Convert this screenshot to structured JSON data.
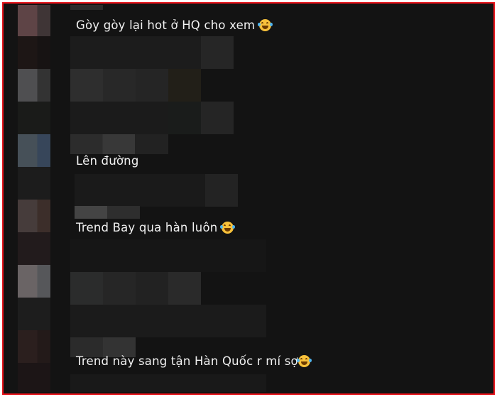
{
  "comments": [
    {
      "text": "Gòy gòy lại hot ở HQ cho xem",
      "emoji": "laughing-tears-icon"
    },
    {
      "text": "Lên đường",
      "emoji": ""
    },
    {
      "text": "Trend Bay qua hàn luôn",
      "emoji": "laughing-tears-icon"
    },
    {
      "text": "Trend này sang tận Hàn Quốc r mí sợ",
      "emoji": "laughing-tears-icon"
    }
  ],
  "colors": {
    "frame_border": "#e8141b",
    "background": "#131313",
    "text": "#f2f2f2"
  }
}
